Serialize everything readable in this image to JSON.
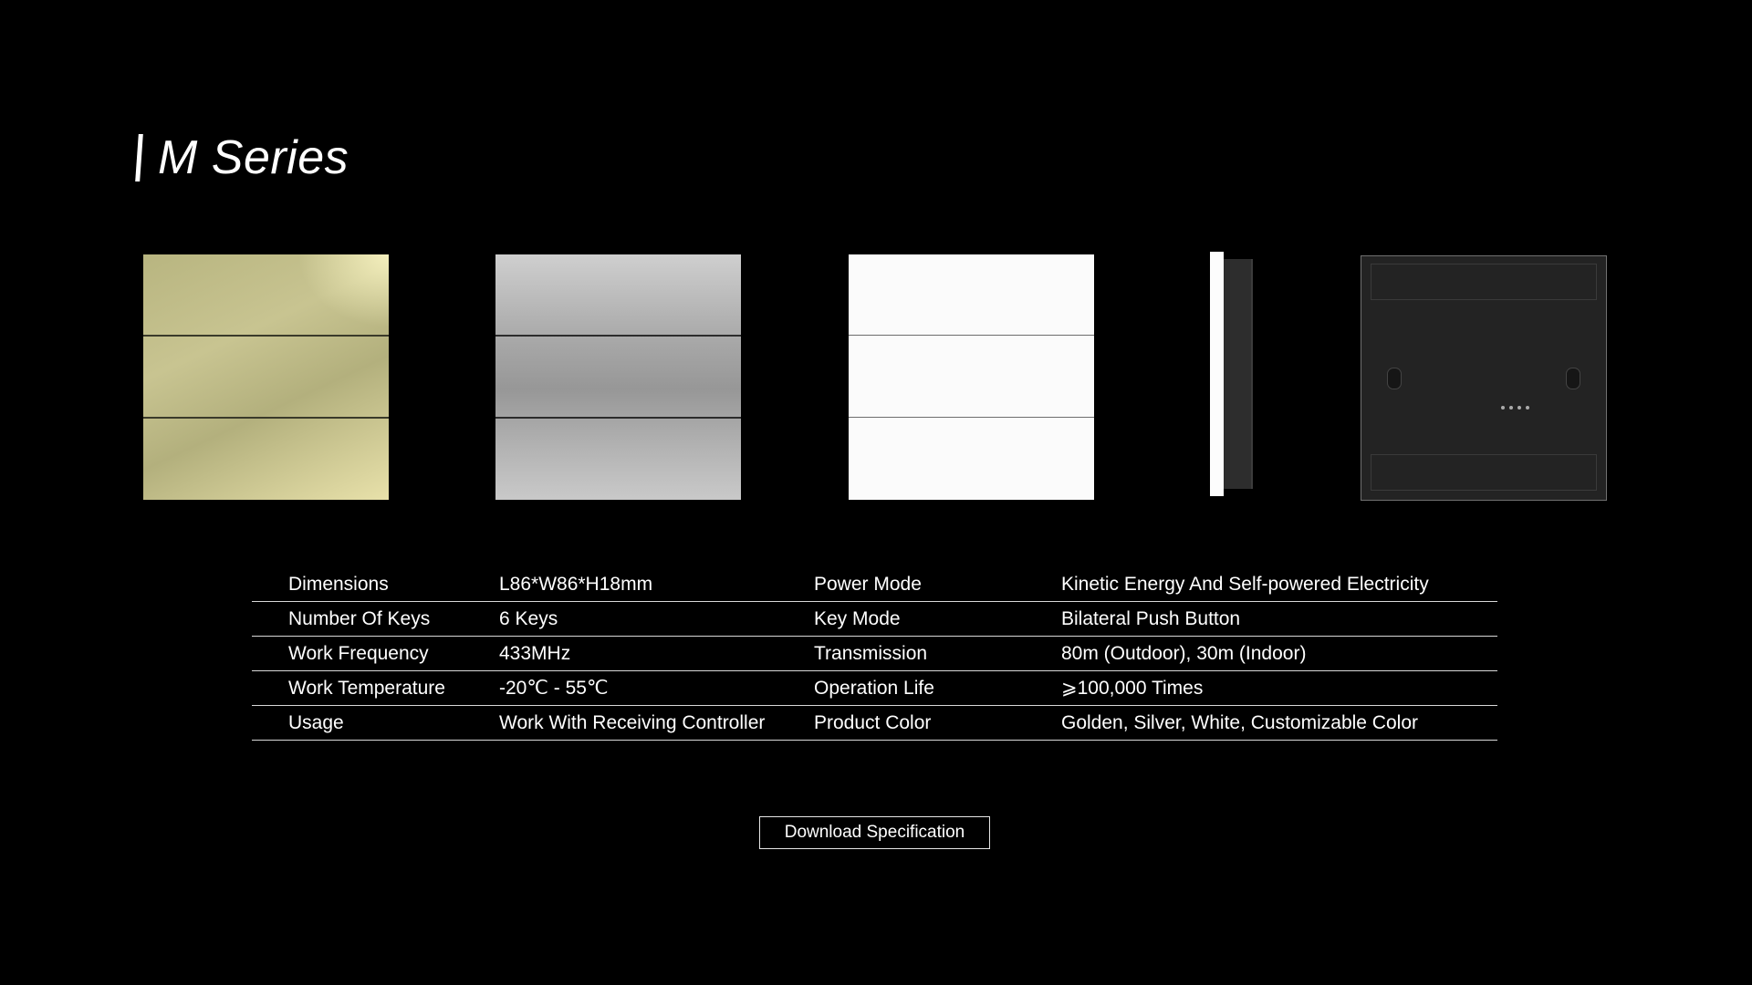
{
  "header": {
    "title": "M Series"
  },
  "products": [
    {
      "name": "golden-panel",
      "color": "#c8c491"
    },
    {
      "name": "silver-panel",
      "color": "#a8a8a8"
    },
    {
      "name": "white-panel",
      "color": "#fbfbfb"
    },
    {
      "name": "side-view",
      "color": "#2d2d2d"
    },
    {
      "name": "back-view",
      "color": "#232323"
    }
  ],
  "specs": [
    {
      "label1": "Dimensions",
      "value1": "L86*W86*H18mm",
      "label2": "Power Mode",
      "value2": "Kinetic Energy And Self-powered Electricity"
    },
    {
      "label1": "Number Of Keys",
      "value1": "6 Keys",
      "label2": "Key Mode",
      "value2": "Bilateral Push Button"
    },
    {
      "label1": "Work Frequency",
      "value1": "433MHz",
      "label2": "Transmission",
      "value2": "80m (Outdoor), 30m (Indoor)"
    },
    {
      "label1": "Work Temperature",
      "value1": "-20℃ - 55℃",
      "label2": "Operation Life",
      "value2": "⩾100,000 Times"
    },
    {
      "label1": "Usage",
      "value1": "Work With Receiving Controller",
      "label2": "Product Color",
      "value2": "Golden, Silver, White, Customizable Color"
    }
  ],
  "actions": {
    "download_label": "Download Specification"
  }
}
